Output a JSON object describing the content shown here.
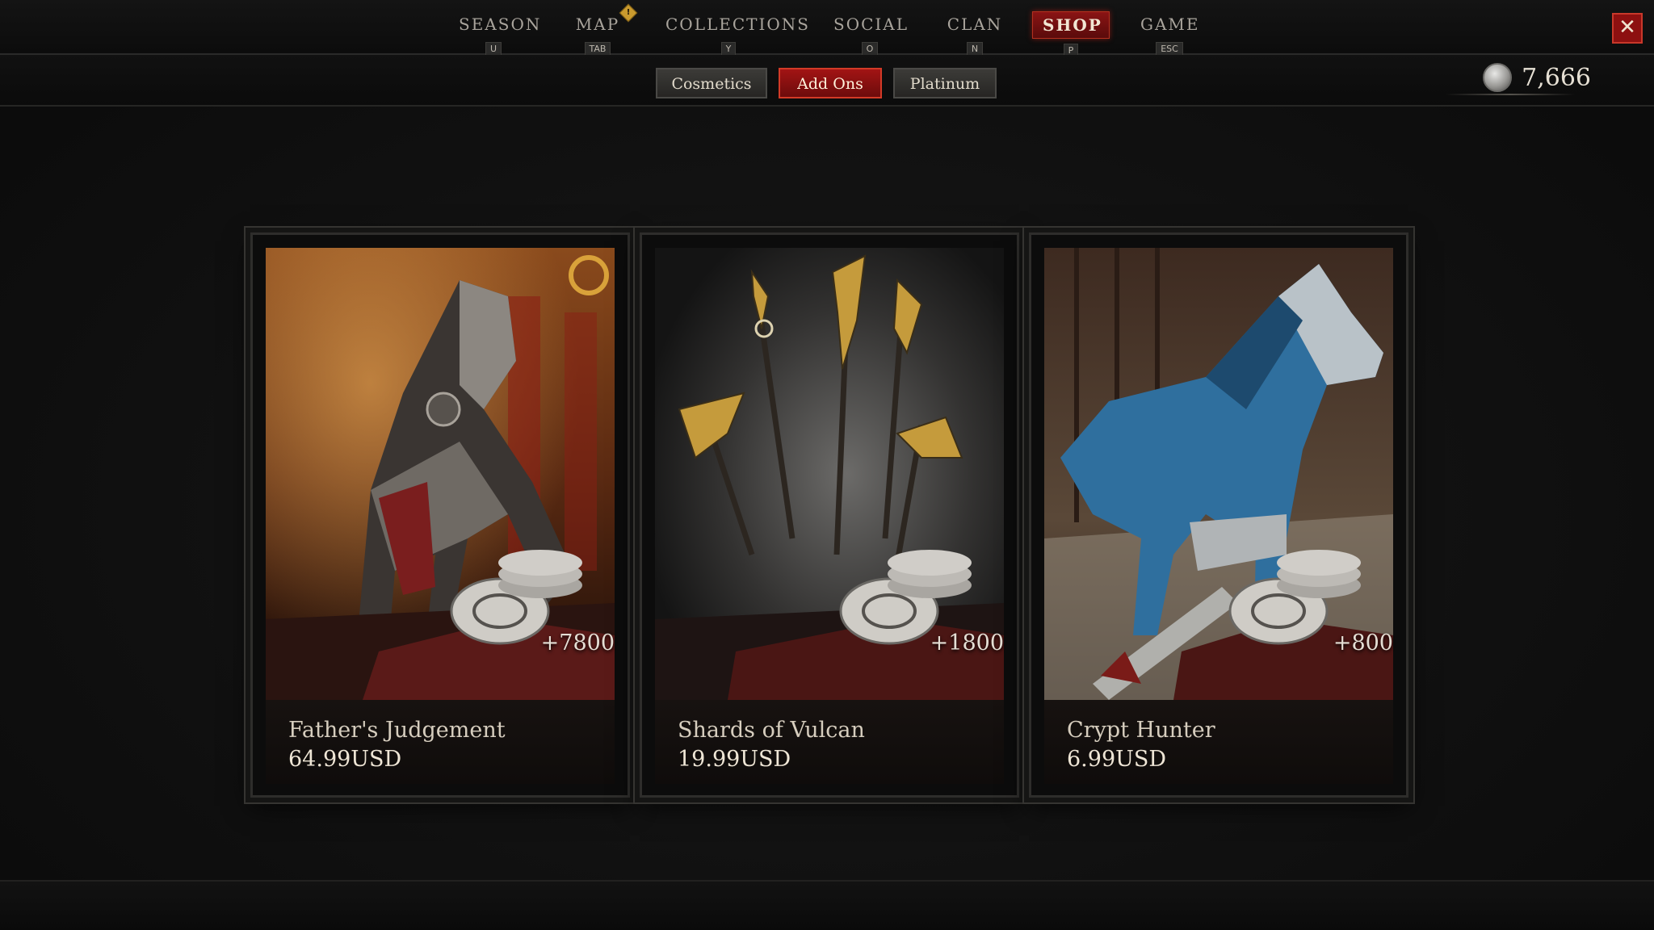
{
  "nav": {
    "items": [
      {
        "label": "SEASON",
        "key": "U"
      },
      {
        "label": "MAP",
        "key": "TAB",
        "badge": "!"
      },
      {
        "label": "COLLECTIONS",
        "key": "Y"
      },
      {
        "label": "SOCIAL",
        "key": "O"
      },
      {
        "label": "CLAN",
        "key": "N"
      },
      {
        "label": "SHOP",
        "key": "P",
        "active": true
      },
      {
        "label": "GAME",
        "key": "ESC"
      }
    ],
    "close_icon": "close-icon"
  },
  "subtabs": [
    {
      "label": "Cosmetics"
    },
    {
      "label": "Add Ons",
      "active": true
    },
    {
      "label": "Platinum"
    }
  ],
  "currency": {
    "amount": "7,666",
    "icon": "platinum-coin-icon"
  },
  "products": [
    {
      "name": "Father's Judgement",
      "price": "64.99USD",
      "bonus": "+7800"
    },
    {
      "name": "Shards of Vulcan",
      "price": "19.99USD",
      "bonus": "+1800"
    },
    {
      "name": "Crypt Hunter",
      "price": "6.99USD",
      "bonus": "+800"
    }
  ],
  "colors": {
    "accent_red": "#a21414",
    "background": "#121212"
  }
}
